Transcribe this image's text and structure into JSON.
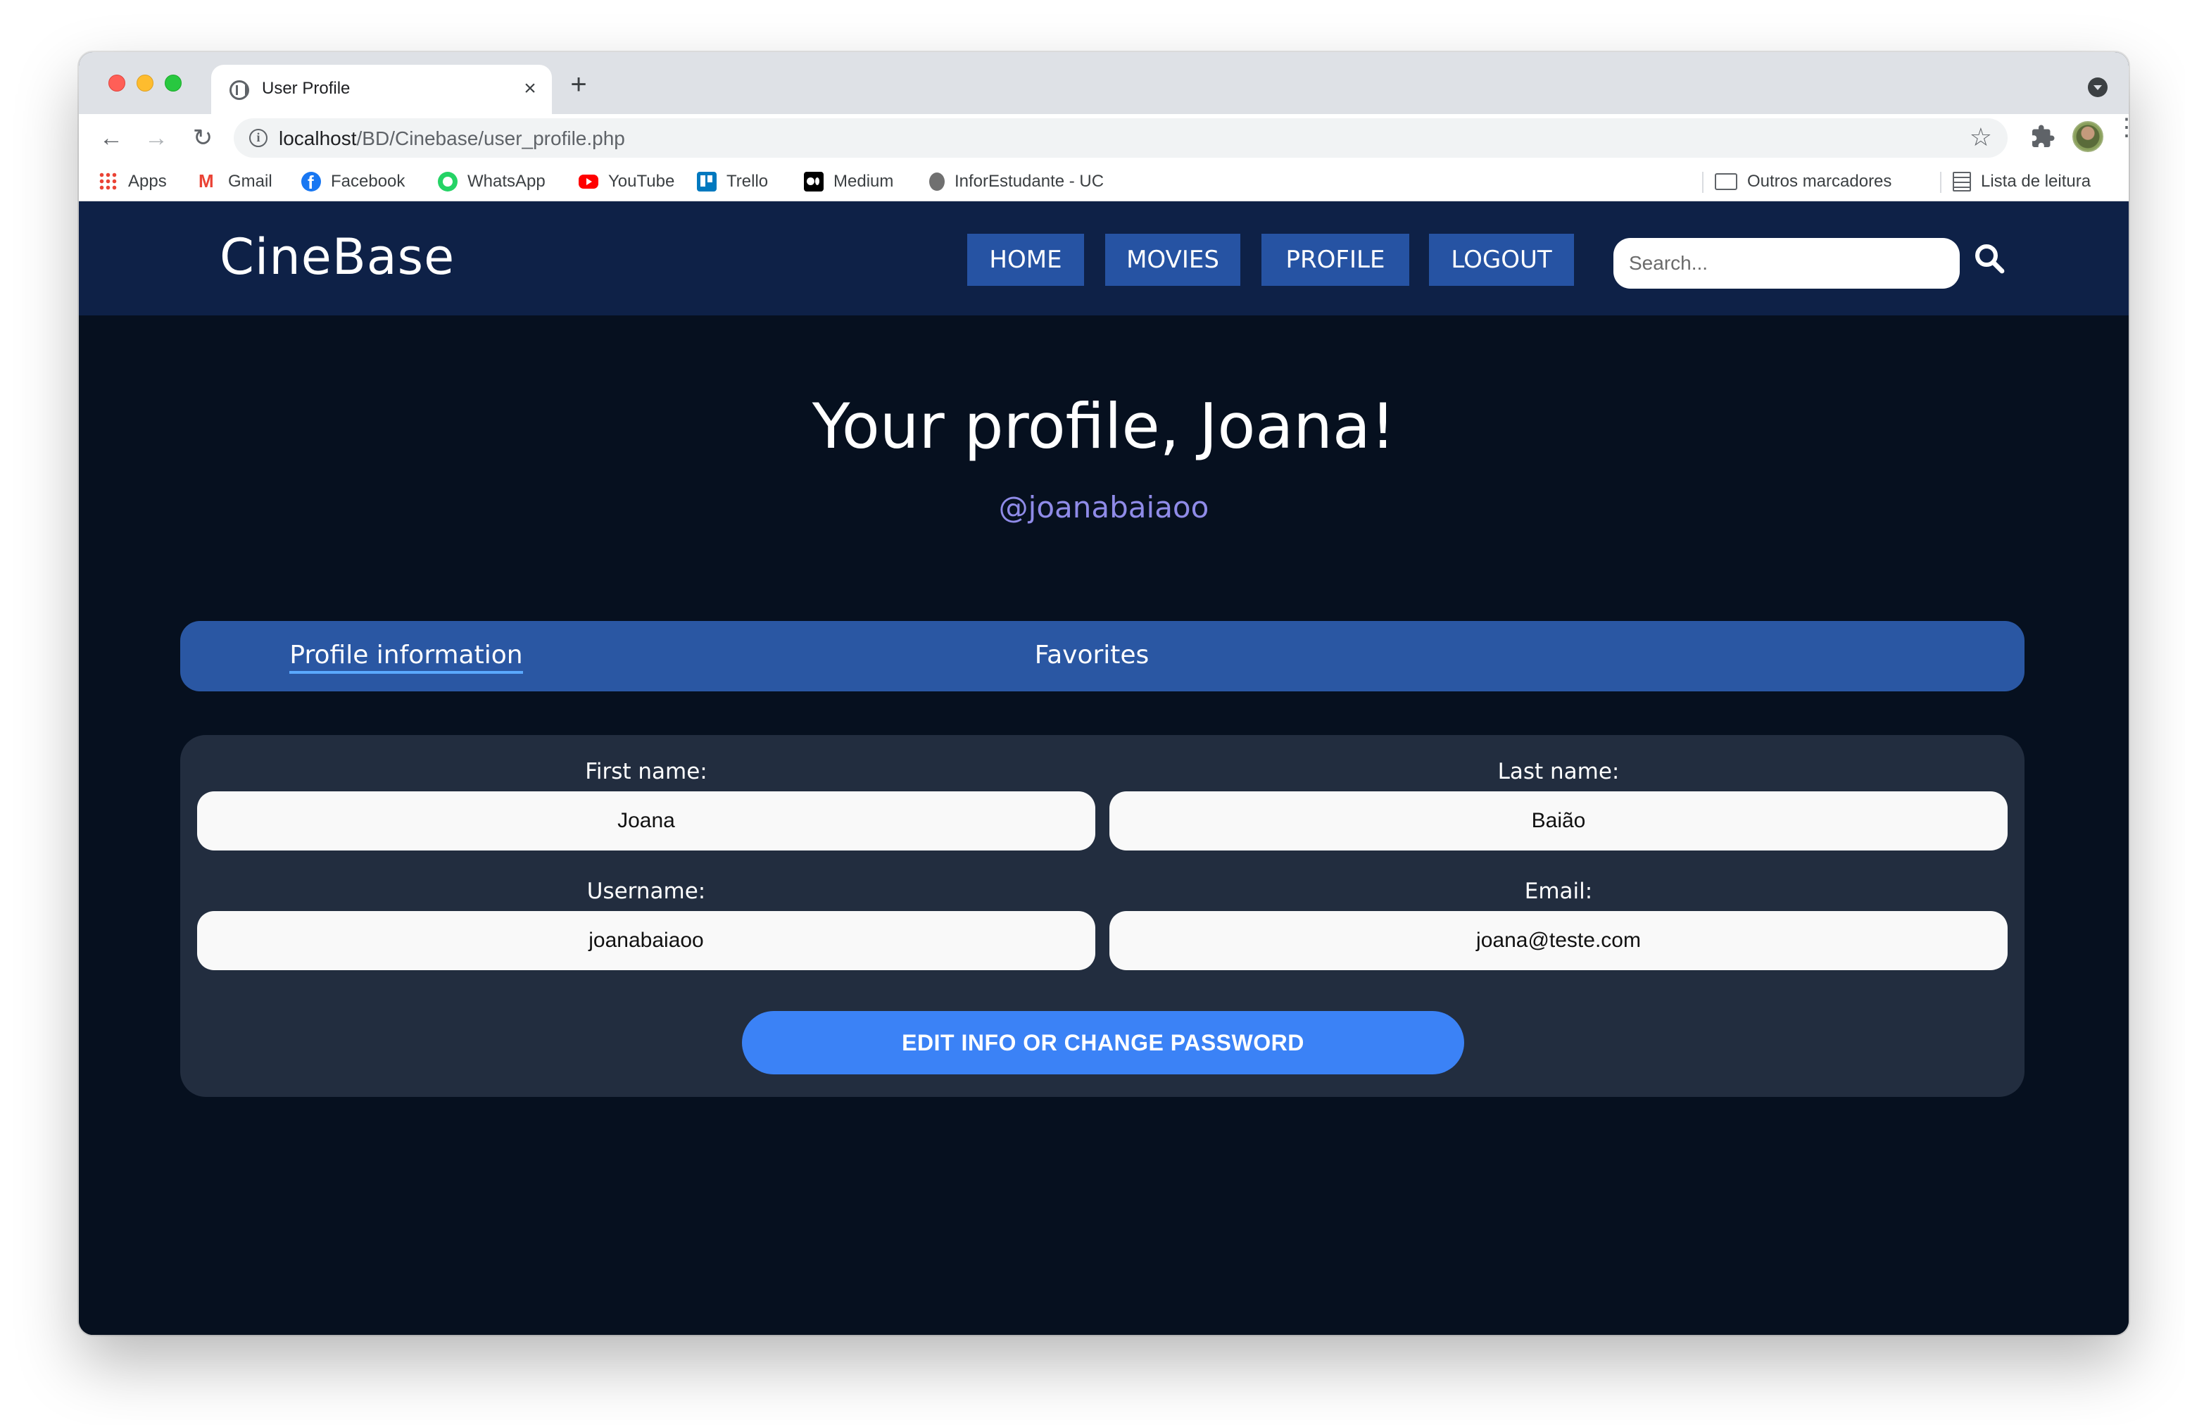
{
  "browser": {
    "tab_title": "User Profile",
    "tab_close": "×",
    "new_tab": "+",
    "url_host": "localhost",
    "url_path": "/BD/Cinebase/user_profile.php",
    "info_glyph": "i",
    "star_glyph": "☆",
    "menu_glyph": "⋮",
    "back_glyph": "←",
    "forward_glyph": "→",
    "reload_glyph": "↻"
  },
  "bookmarks": {
    "items": [
      {
        "label": "Apps",
        "icon": "apps-grid-icon"
      },
      {
        "label": "Gmail",
        "icon": "gmail-icon"
      },
      {
        "label": "Facebook",
        "icon": "facebook-icon"
      },
      {
        "label": "WhatsApp",
        "icon": "whatsapp-icon"
      },
      {
        "label": "YouTube",
        "icon": "youtube-icon"
      },
      {
        "label": "Trello",
        "icon": "trello-icon"
      },
      {
        "label": "Medium",
        "icon": "medium-icon"
      },
      {
        "label": "InforEstudante - UC",
        "icon": "uc-icon"
      }
    ],
    "other_bookmarks": "Outros marcadores",
    "reading_list": "Lista de leitura"
  },
  "site": {
    "brand": "CineBase",
    "nav": [
      "HOME",
      "MOVIES",
      "PROFILE",
      "LOGOUT"
    ],
    "search_placeholder": "Search...",
    "colors": {
      "header_bg": "#0e2147",
      "nav_button": "#2653a3",
      "page_bg": "#06101f",
      "tabs_bar": "#2a57a3",
      "card_bg": "#222d3f",
      "accent_button": "#3b82f6",
      "handle_text": "#8f8be8"
    }
  },
  "profile": {
    "title": "Your profile, Joana!",
    "handle": "@joanabaiaoo",
    "tabs": [
      "Profile information",
      "Favorites"
    ],
    "active_tab": "Profile information",
    "fields": {
      "first_name_label": "First name:",
      "first_name_value": "Joana",
      "last_name_label": "Last name:",
      "last_name_value": "Baião",
      "username_label": "Username:",
      "username_value": "joanabaiaoo",
      "email_label": "Email:",
      "email_value": "joana@teste.com"
    },
    "edit_button": "EDIT INFO OR CHANGE PASSWORD"
  }
}
